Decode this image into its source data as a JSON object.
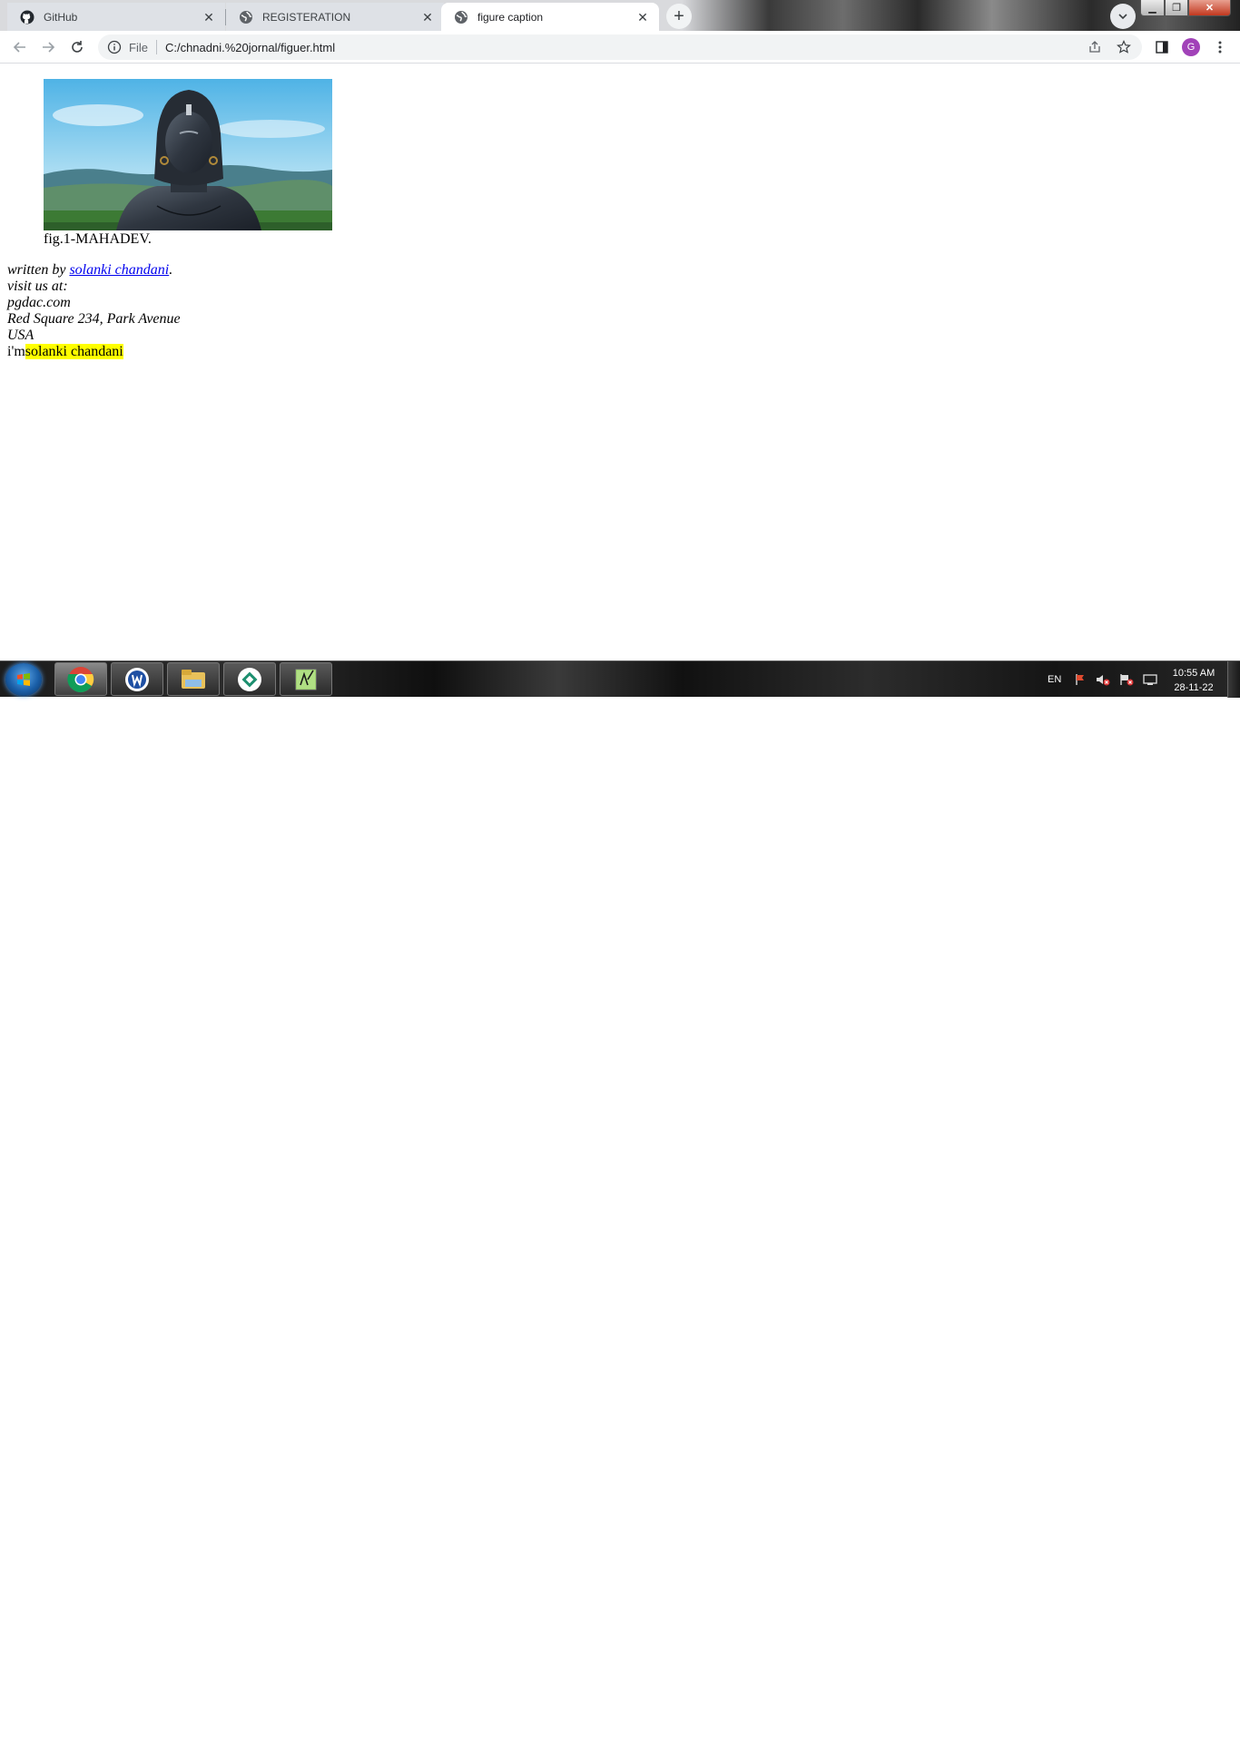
{
  "browser": {
    "tabs": [
      {
        "title": "GitHub",
        "icon": "github-icon",
        "active": false
      },
      {
        "title": "REGISTERATION",
        "icon": "globe-icon",
        "active": false
      },
      {
        "title": "figure caption",
        "icon": "globe-icon",
        "active": true
      }
    ],
    "omnibox": {
      "scheme": "File",
      "url": "C:/chnadni.%20jornal/figuer.html"
    },
    "profile_initial": "G",
    "colors": {
      "profile": "#a142b8",
      "active_tab": "#ffffff",
      "tab_strip": "#dee1e6"
    }
  },
  "page": {
    "figure": {
      "image_alt": "MAHADEV statue",
      "caption": "fig.1-MAHADEV."
    },
    "address": {
      "written_by_prefix": "written by ",
      "author_link": "solanki chandani",
      "written_by_suffix": ".",
      "visit_label": "visit us at:",
      "site": "pgdac.com",
      "street": "Red Square 234, Park Avenue",
      "country": "USA"
    },
    "intro": {
      "prefix": "i'm",
      "highlighted": "solanki chandani"
    },
    "colors": {
      "link": "#0000ee",
      "highlight": "#ffff00"
    }
  },
  "taskbar": {
    "apps": [
      {
        "name": "chrome-icon",
        "active": true
      },
      {
        "name": "writer-app-icon",
        "active": false
      },
      {
        "name": "file-explorer-icon",
        "active": false
      },
      {
        "name": "network-app-icon",
        "active": false
      },
      {
        "name": "notepad-plus-plus-icon",
        "active": false
      }
    ],
    "language": "EN",
    "time": "10:55 AM",
    "date": "28-11-22"
  }
}
